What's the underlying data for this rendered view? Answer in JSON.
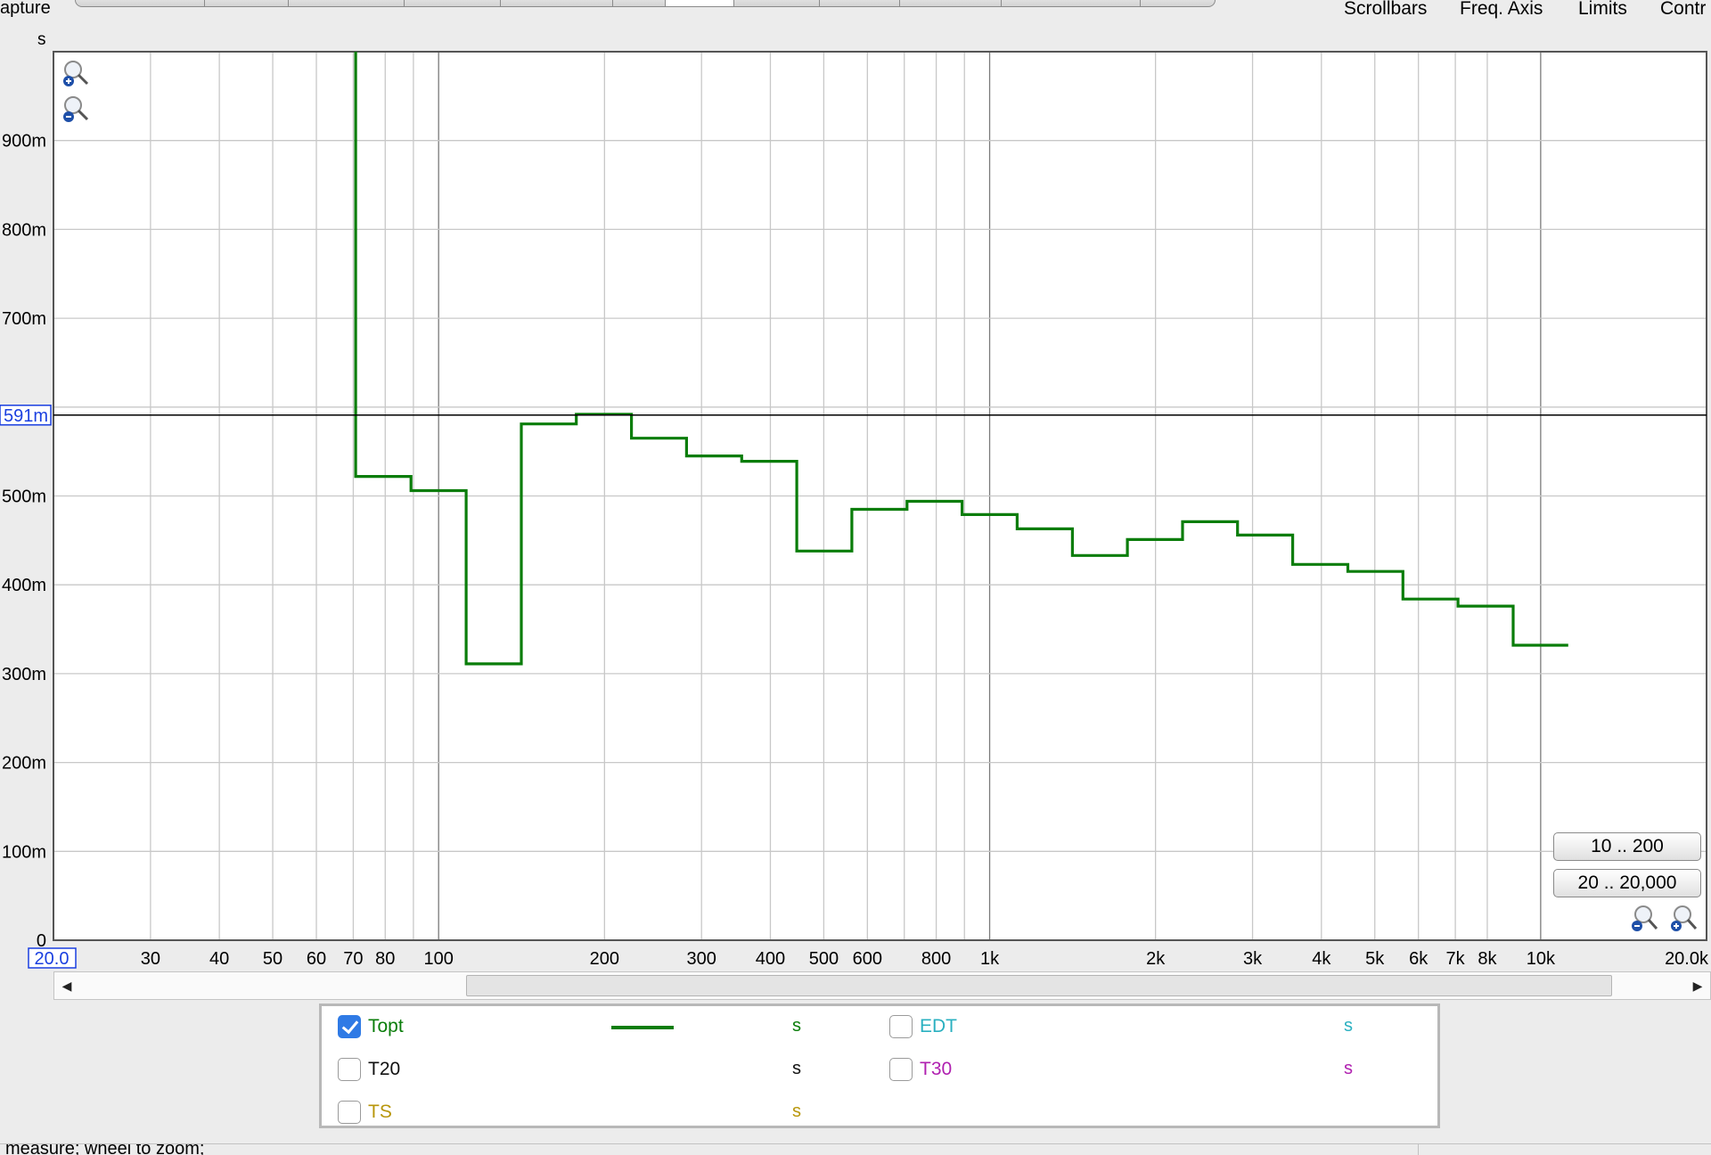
{
  "header": {
    "partial_title": "apture",
    "unit": "s",
    "menus": [
      "Scrollbars",
      "Freq. Axis",
      "Limits",
      "Contr"
    ]
  },
  "chart_data": {
    "type": "line",
    "x_scale": "log",
    "xlim": [
      20,
      20000
    ],
    "ylim": [
      0,
      1.0
    ],
    "y_unit": "s",
    "y_ticks": [
      {
        "value": 0,
        "label": "0"
      },
      {
        "value": 0.1,
        "label": "100m"
      },
      {
        "value": 0.2,
        "label": "200m"
      },
      {
        "value": 0.3,
        "label": "300m"
      },
      {
        "value": 0.4,
        "label": "400m"
      },
      {
        "value": 0.5,
        "label": "500m"
      },
      {
        "value": 0.7,
        "label": "700m"
      },
      {
        "value": 0.8,
        "label": "800m"
      },
      {
        "value": 0.9,
        "label": "900m"
      }
    ],
    "x_ticks": [
      {
        "value": 30,
        "label": "30"
      },
      {
        "value": 40,
        "label": "40"
      },
      {
        "value": 50,
        "label": "50"
      },
      {
        "value": 60,
        "label": "60"
      },
      {
        "value": 70,
        "label": "70"
      },
      {
        "value": 80,
        "label": "80"
      },
      {
        "value": 100,
        "label": "100"
      },
      {
        "value": 200,
        "label": "200"
      },
      {
        "value": 300,
        "label": "300"
      },
      {
        "value": 400,
        "label": "400"
      },
      {
        "value": 500,
        "label": "500"
      },
      {
        "value": 600,
        "label": "600"
      },
      {
        "value": 800,
        "label": "800"
      },
      {
        "value": 1000,
        "label": "1k"
      },
      {
        "value": 2000,
        "label": "2k"
      },
      {
        "value": 3000,
        "label": "3k"
      },
      {
        "value": 4000,
        "label": "4k"
      },
      {
        "value": 5000,
        "label": "5k"
      },
      {
        "value": 6000,
        "label": "6k"
      },
      {
        "value": 7000,
        "label": "7k"
      },
      {
        "value": 8000,
        "label": "8k"
      },
      {
        "value": 10000,
        "label": "10k"
      },
      {
        "value": 20000,
        "label": "20.0k"
      }
    ],
    "x_min_label": "20.0",
    "grid": true,
    "cursor": {
      "value": 0.591,
      "label": "591m"
    },
    "series": [
      {
        "name": "Topt",
        "color": "#0a7d0a",
        "steps": [
          {
            "x0": 70.7,
            "x1": 89.1,
            "y": 0.522
          },
          {
            "x0": 89.1,
            "x1": 112.2,
            "y": 0.506
          },
          {
            "x0": 112.2,
            "x1": 141.3,
            "y": 0.311
          },
          {
            "x0": 141.3,
            "x1": 177.8,
            "y": 0.581
          },
          {
            "x0": 177.8,
            "x1": 223.9,
            "y": 0.592
          },
          {
            "x0": 223.9,
            "x1": 281.8,
            "y": 0.565
          },
          {
            "x0": 281.8,
            "x1": 354.8,
            "y": 0.545
          },
          {
            "x0": 354.8,
            "x1": 446.7,
            "y": 0.539
          },
          {
            "x0": 446.7,
            "x1": 562.3,
            "y": 0.438
          },
          {
            "x0": 562.3,
            "x1": 707.9,
            "y": 0.485
          },
          {
            "x0": 707.9,
            "x1": 891.3,
            "y": 0.494
          },
          {
            "x0": 891.3,
            "x1": 1122,
            "y": 0.479
          },
          {
            "x0": 1122,
            "x1": 1413,
            "y": 0.463
          },
          {
            "x0": 1413,
            "x1": 1778,
            "y": 0.433
          },
          {
            "x0": 1778,
            "x1": 2239,
            "y": 0.451
          },
          {
            "x0": 2239,
            "x1": 2818,
            "y": 0.471
          },
          {
            "x0": 2818,
            "x1": 3548,
            "y": 0.456
          },
          {
            "x0": 3548,
            "x1": 4467,
            "y": 0.423
          },
          {
            "x0": 4467,
            "x1": 5623,
            "y": 0.415
          },
          {
            "x0": 5623,
            "x1": 7079,
            "y": 0.384
          },
          {
            "x0": 7079,
            "x1": 8913,
            "y": 0.376
          },
          {
            "x0": 8913,
            "x1": 11220,
            "y": 0.332
          }
        ],
        "start_spike": {
          "x": 70.7,
          "y_top": 1.0
        }
      }
    ]
  },
  "range_buttons": [
    "10 .. 200",
    "20 .. 20,000"
  ],
  "legend": [
    {
      "name": "Topt",
      "unit": "s",
      "checked": true,
      "color": "#0a7d0a",
      "unit_color": "#0a7d0a"
    },
    {
      "name": "EDT",
      "unit": "s",
      "checked": false,
      "color": "#2ab0c0",
      "unit_color": "#2ab0c0"
    },
    {
      "name": "T20",
      "unit": "s",
      "checked": false,
      "color": "#111111",
      "unit_color": "#111111"
    },
    {
      "name": "T30",
      "unit": "s",
      "checked": false,
      "color": "#b020b0",
      "unit_color": "#b020b0"
    },
    {
      "name": "TS",
      "unit": "s",
      "checked": false,
      "color": "#b8960a",
      "unit_color": "#b8960a"
    }
  ],
  "status": {
    "text": "measure; wheel to zoom;"
  },
  "icons": [
    "zoom-in-icon",
    "zoom-out-icon",
    "scroll-left-icon",
    "scroll-right-icon",
    "checkmark-icon"
  ]
}
